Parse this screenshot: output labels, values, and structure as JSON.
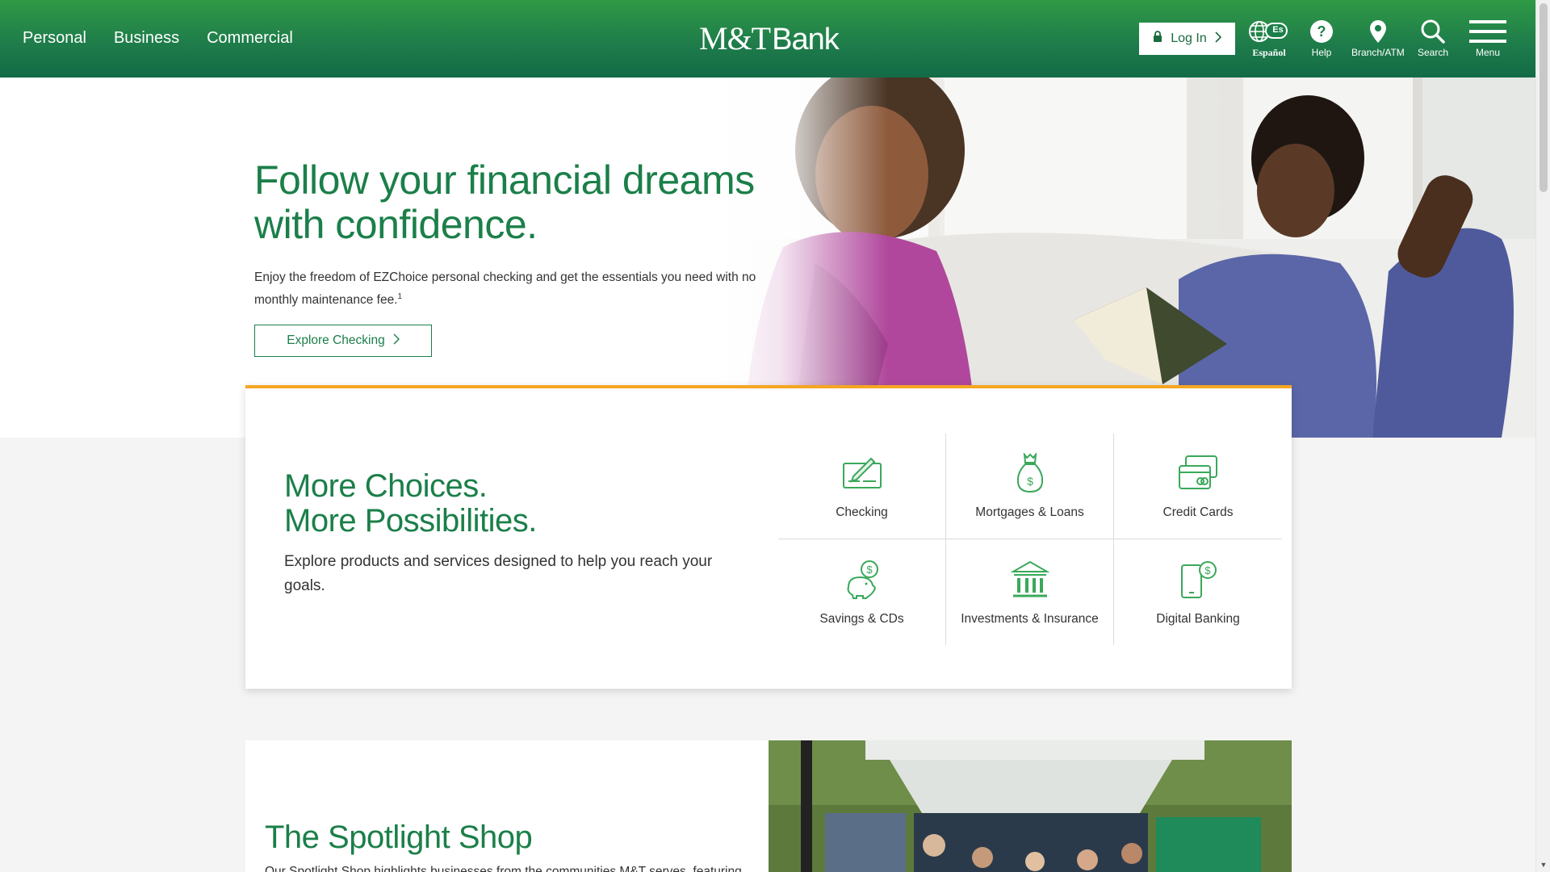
{
  "header": {
    "primary_nav": [
      "Personal",
      "Business",
      "Commercial"
    ],
    "logo_mt": "M&T",
    "logo_bank": "Bank",
    "login_label": "Log In",
    "espanol_badge": "Es",
    "espanol_label": "Español",
    "help_label": "Help",
    "branch_label": "Branch/ATM",
    "search_label": "Search",
    "menu_label": "Menu"
  },
  "hero": {
    "title": "Follow your financial dreams with confidence.",
    "description": "Enjoy the freedom of EZChoice personal checking and get the essentials you need with no monthly maintenance fee.",
    "footnote": "1",
    "cta_label": "Explore Checking"
  },
  "choices": {
    "title_line1": "More Choices.",
    "title_line2": "More Possibilities.",
    "description": "Explore products and services designed to help you reach your goals.",
    "tiles": [
      {
        "label": "Checking",
        "icon": "checking-icon"
      },
      {
        "label": "Mortgages & Loans",
        "icon": "money-bag-icon"
      },
      {
        "label": "Credit Cards",
        "icon": "credit-cards-icon"
      },
      {
        "label": "Savings & CDs",
        "icon": "piggy-bank-icon"
      },
      {
        "label": "Investments & Insurance",
        "icon": "bank-building-icon"
      },
      {
        "label": "Digital Banking",
        "icon": "mobile-dollar-icon"
      }
    ]
  },
  "spotlight": {
    "title": "The Spotlight Shop",
    "description": "Our Spotlight Shop highlights businesses from the communities M&T serves, featuring"
  },
  "colors": {
    "brand_green": "#1b7f49",
    "header_green_top": "#2f9a46",
    "header_green_bottom": "#136b47",
    "accent_gold": "#f5a623",
    "icon_green": "#3aa85a"
  }
}
